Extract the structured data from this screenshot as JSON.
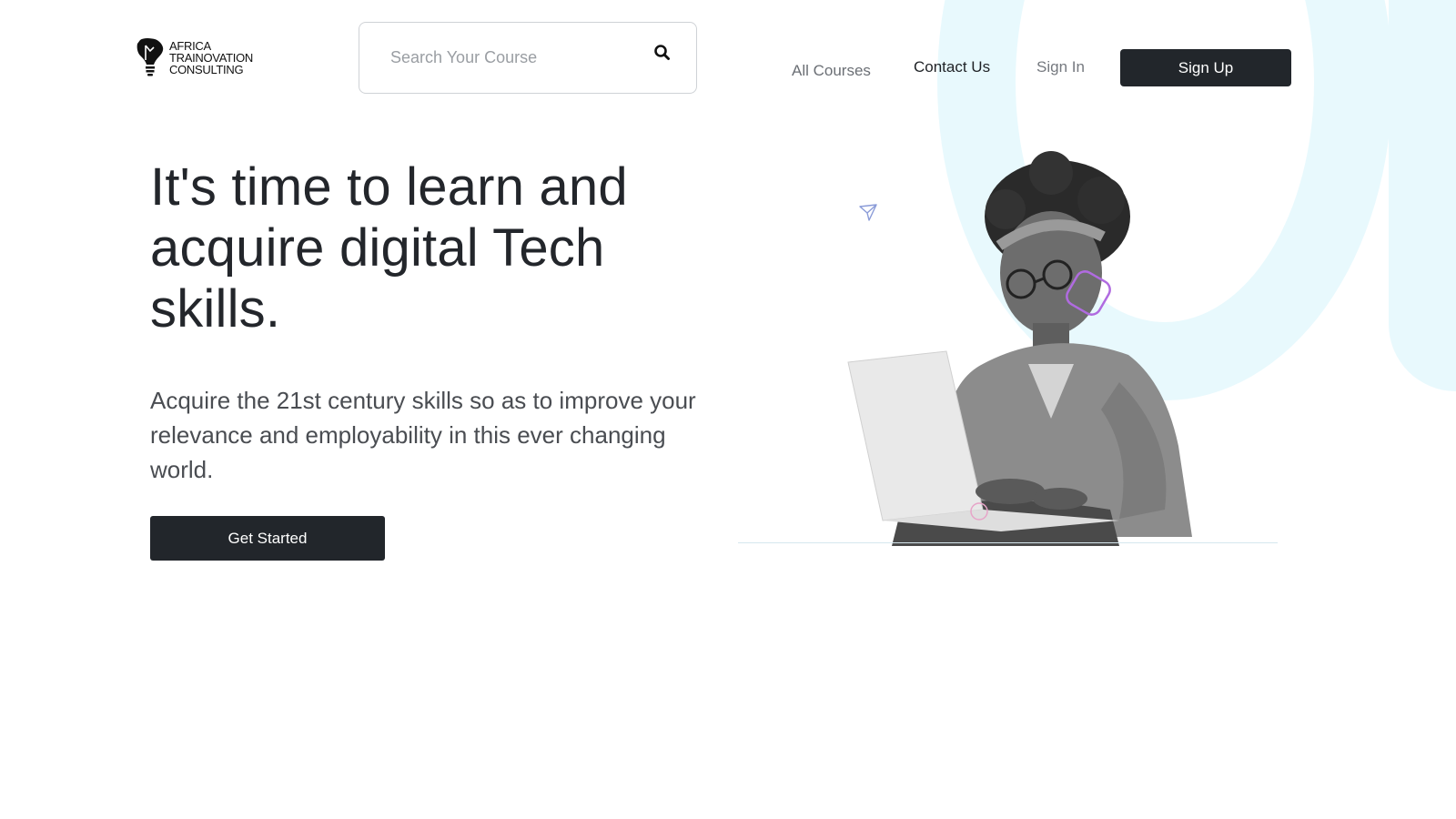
{
  "brand": {
    "logo_lines": [
      "AFRICA",
      "TRAINOVATION",
      "CONSULTING"
    ]
  },
  "search": {
    "placeholder": "Search Your Course",
    "icon": "search-icon"
  },
  "nav": {
    "all_courses": "All Courses",
    "contact_us": "Contact Us",
    "sign_in": "Sign In",
    "sign_up": "Sign Up"
  },
  "hero": {
    "title": "It's time to learn and acquire digital Tech skills.",
    "subtitle": "Acquire the 21st century skills so as to improve your relevance and employability in this ever changing world.",
    "cta": "Get Started"
  },
  "colors": {
    "primary_dark": "#22262b",
    "accent_ring": "#e8f9fd",
    "accent_purple": "#b06be0",
    "plane_blue": "#8a9bd8"
  }
}
